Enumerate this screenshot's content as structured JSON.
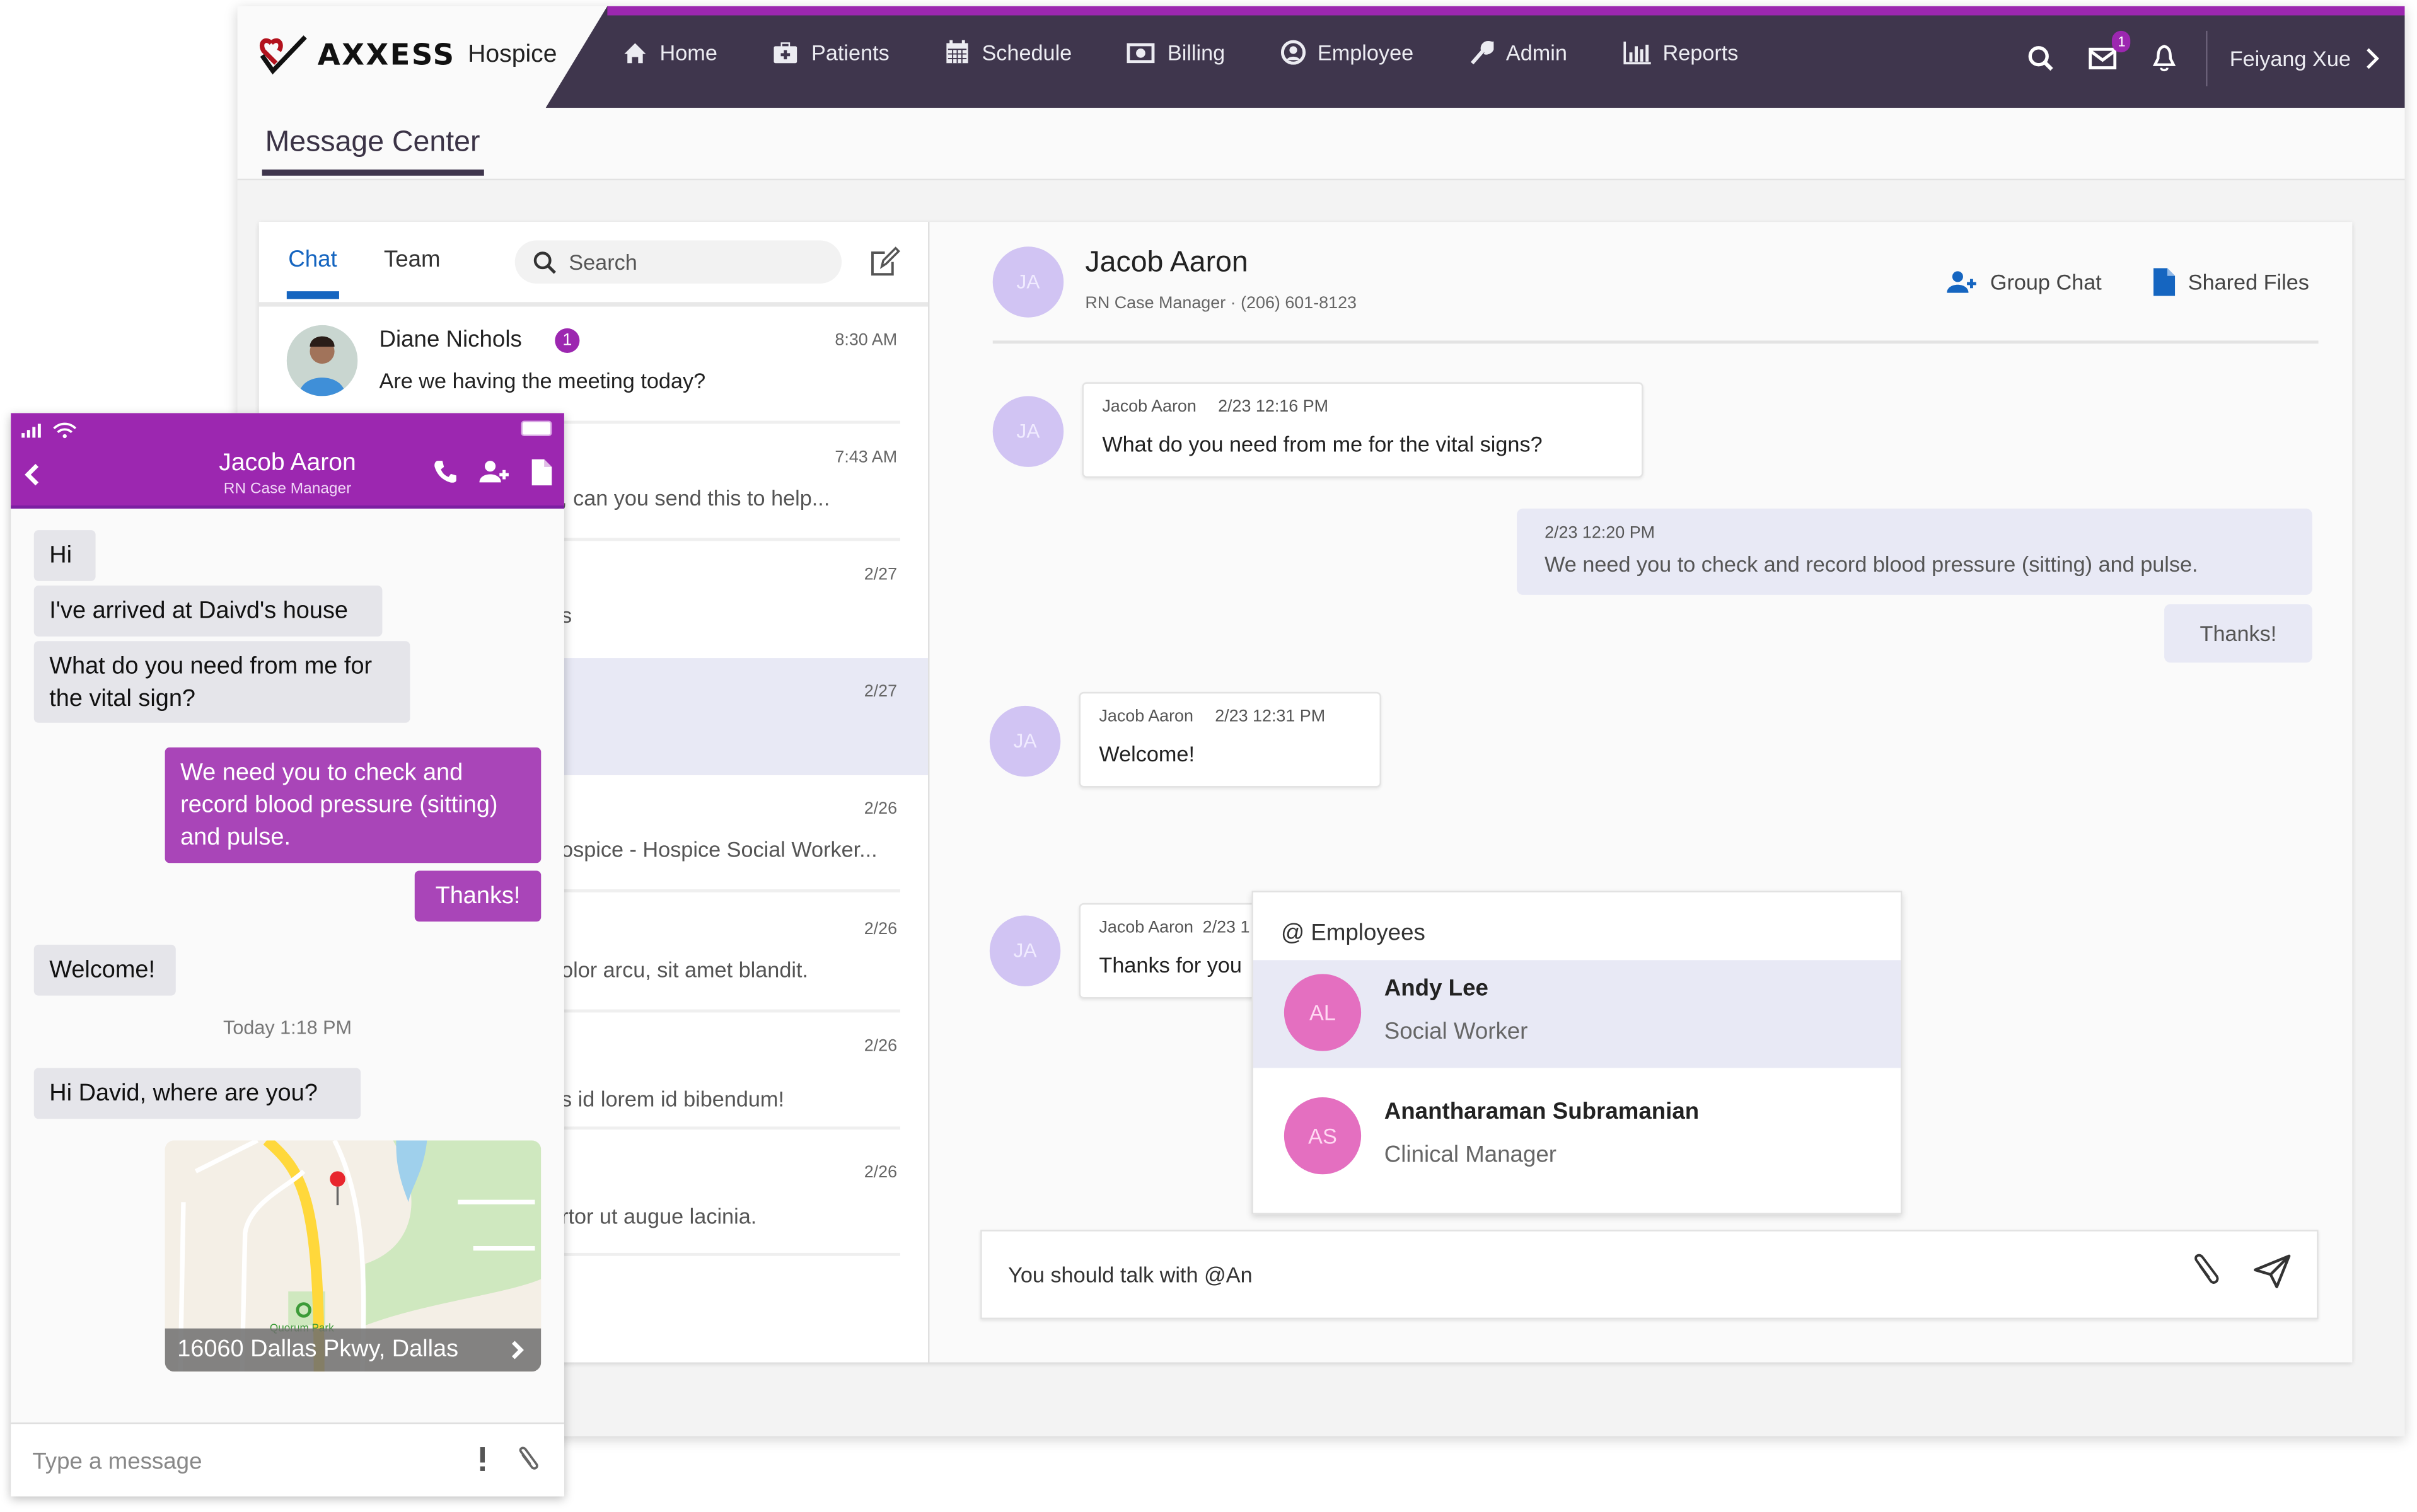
{
  "app": {
    "logo": {
      "brand": "AXXESS",
      "product": "Hospice"
    },
    "nav": [
      {
        "label": "Home",
        "icon": "home-icon"
      },
      {
        "label": "Patients",
        "icon": "medkit-icon"
      },
      {
        "label": "Schedule",
        "icon": "calendar-icon"
      },
      {
        "label": "Billing",
        "icon": "money-icon"
      },
      {
        "label": "Employee",
        "icon": "user-circle-icon"
      },
      {
        "label": "Admin",
        "icon": "wrench-icon"
      },
      {
        "label": "Reports",
        "icon": "bar-chart-icon"
      }
    ],
    "header_right": {
      "messages_badge": "1",
      "user_name": "Feiyang Xue"
    },
    "page_title": "Message Center",
    "colors": {
      "nav_bg": "#3f364d",
      "accent": "#9c27b0",
      "link_blue": "#1565c0",
      "avatar_lavender": "#d1c4f3",
      "avatar_pink": "#e46fc0",
      "selected_bg": "#e8e9f5"
    }
  },
  "list": {
    "tabs": [
      {
        "label": "Chat",
        "active": true
      },
      {
        "label": "Team",
        "active": false
      }
    ],
    "search_placeholder": "Search",
    "conversations": [
      {
        "name": "Diane Nichols",
        "unread": "1",
        "time": "8:30 AM",
        "preview": "Are we having the meeting today?"
      },
      {
        "name": "",
        "time": "7:43 AM",
        "preview": ", can you send this to help..."
      },
      {
        "name": "",
        "time": "2/27",
        "preview": "s"
      },
      {
        "name": "",
        "time": "2/27",
        "preview": "",
        "selected": true
      },
      {
        "name": "",
        "time": "2/26",
        "preview": "ospice - Hospice Social Worker..."
      },
      {
        "name": "",
        "time": "2/26",
        "preview": "olor arcu, sit amet blandit."
      },
      {
        "name": "",
        "time": "2/26",
        "preview": "s id lorem id bibendum!"
      },
      {
        "name": "",
        "time": "2/26",
        "preview": "rtor ut augue lacinia."
      }
    ]
  },
  "chat": {
    "contact": {
      "initials": "JA",
      "name": "Jacob Aaron",
      "subtitle": "RN Case Manager · (206) 601-8123"
    },
    "actions": {
      "group_chat": "Group Chat",
      "shared_files": "Shared Files"
    },
    "messages": [
      {
        "from": "Jacob Aaron",
        "initials": "JA",
        "time": "2/23 12:16 PM",
        "text": "What do you need from me for the vital signs?",
        "outgoing": false
      },
      {
        "time": "2/23 12:20 PM",
        "text": "We need you to check and record blood pressure (sitting) and pulse.",
        "outgoing": true
      },
      {
        "text": "Thanks!",
        "outgoing": true
      },
      {
        "from": "Jacob Aaron",
        "initials": "JA",
        "time": "2/23 12:31 PM",
        "text": "Welcome!",
        "outgoing": false
      },
      {
        "from": "Jacob Aaron",
        "initials": "JA",
        "time": "2/23 1",
        "text": "Thanks for you",
        "outgoing": false
      }
    ],
    "mention": {
      "header": "@ Employees",
      "items": [
        {
          "initials": "AL",
          "name": "Andy Lee",
          "role": "Social Worker",
          "selected": true
        },
        {
          "initials": "AS",
          "name": "Anantharaman Subramanian",
          "role": "Clinical Manager",
          "selected": false
        }
      ]
    },
    "composer_value": "You should talk with @An"
  },
  "mobile": {
    "title": "Jacob Aaron",
    "subtitle": "RN Case Manager",
    "messages": [
      {
        "text": "Hi",
        "me": false
      },
      {
        "text": "I've arrived at Daivd's house",
        "me": false
      },
      {
        "text": "What do you need from me for the vital sign?",
        "me": false
      },
      {
        "text": "We need you to check and record blood pressure (sitting) and pulse.",
        "me": true
      },
      {
        "text": "Thanks!",
        "me": true
      },
      {
        "text": "Welcome!",
        "me": false
      },
      {
        "text": "Hi David, where are you?",
        "me": false
      }
    ],
    "timestamp": "Today 1:18 PM",
    "map": {
      "address": "16060 Dallas Pkwy, Dallas",
      "park_label": "Quorum Park"
    },
    "input_placeholder": "Type a message"
  }
}
